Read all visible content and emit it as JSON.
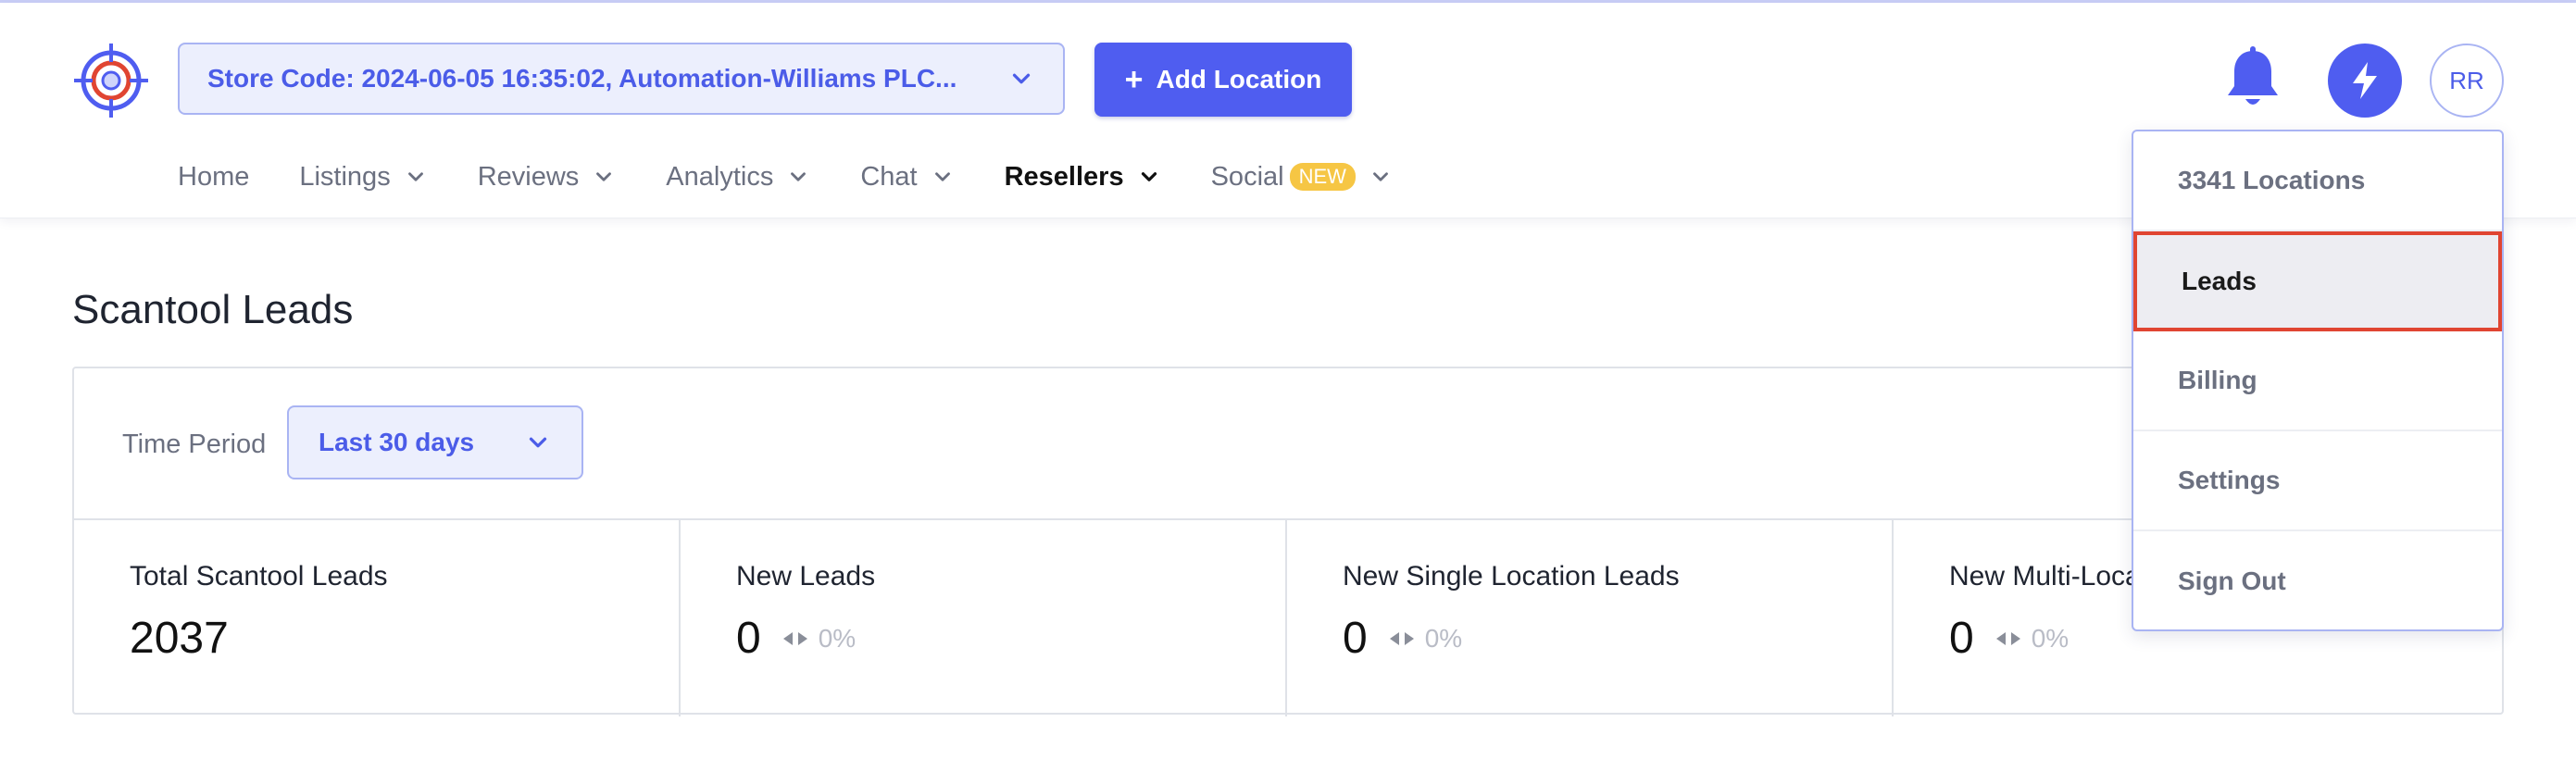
{
  "header": {
    "store_selector": "Store Code: 2024-06-05 16:35:02, Automation-Williams PLC...",
    "add_location": "Add Location",
    "avatar_initials": "RR",
    "logo_icon": "target-logo-icon",
    "notification_icon": "bell-icon",
    "quick_action_icon": "lightning-bolt-icon",
    "accent_color": "#4f5df0"
  },
  "nav": {
    "items": [
      {
        "label": "Home"
      },
      {
        "label": "Listings"
      },
      {
        "label": "Reviews"
      },
      {
        "label": "Analytics"
      },
      {
        "label": "Chat"
      },
      {
        "label": "Resellers",
        "active": true
      },
      {
        "label": "Social",
        "badge": "NEW"
      }
    ]
  },
  "main": {
    "title": "Scantool Leads",
    "time_period_label": "Time Period",
    "time_period_value": "Last 30 days",
    "stats": [
      {
        "label": "Total Scantool Leads",
        "value": "2037"
      },
      {
        "label": "New Leads",
        "value": "0",
        "change": "0%"
      },
      {
        "label": "New Single Location Leads",
        "value": "0",
        "change": "0%"
      },
      {
        "label": "New Multi-Location Leads",
        "value": "0",
        "change": "0%"
      }
    ]
  },
  "dropdown": {
    "items": [
      {
        "label": "3341 Locations"
      },
      {
        "label": "Leads",
        "selected": true
      },
      {
        "label": "Billing"
      },
      {
        "label": "Settings"
      },
      {
        "label": "Sign Out"
      }
    ]
  }
}
